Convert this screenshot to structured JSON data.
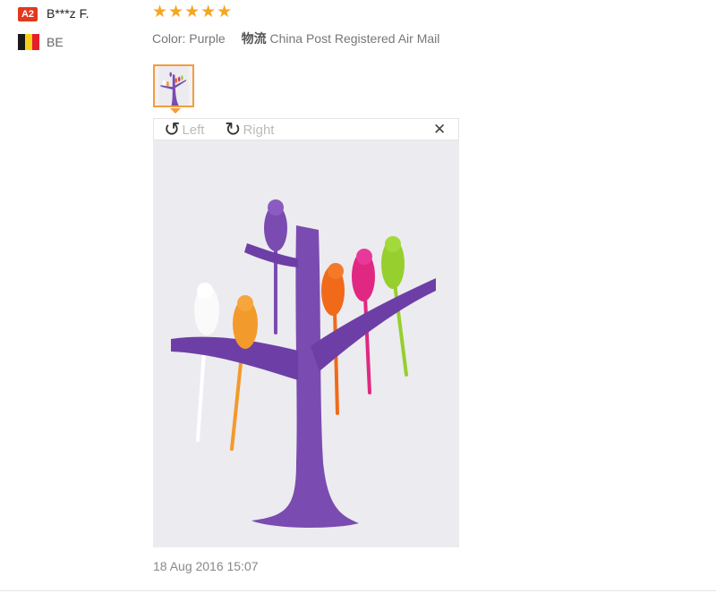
{
  "buyer": {
    "level": "A2",
    "name": "B***z F.",
    "country": "BE",
    "flag_colors": [
      "#1a1a1a",
      "#f7d117",
      "#e41e2b"
    ]
  },
  "review": {
    "stars": "★★★★★",
    "rating": 5,
    "color_label": "Color:",
    "color_value": "Purple",
    "shipping_icon": "物流",
    "shipping_method": "China Post Registered Air Mail",
    "date": "18 Aug 2016 15:07"
  },
  "viewer": {
    "rotate_left_label": "Left",
    "rotate_right_label": "Right",
    "rotate_left_icon": "↺",
    "rotate_right_icon": "↻",
    "close_icon": "✕"
  },
  "colors": {
    "star": "#f5a623",
    "badge": "#e2381f",
    "thumb_border": "#f39c3c",
    "product_purple": "#7a4bb0"
  }
}
